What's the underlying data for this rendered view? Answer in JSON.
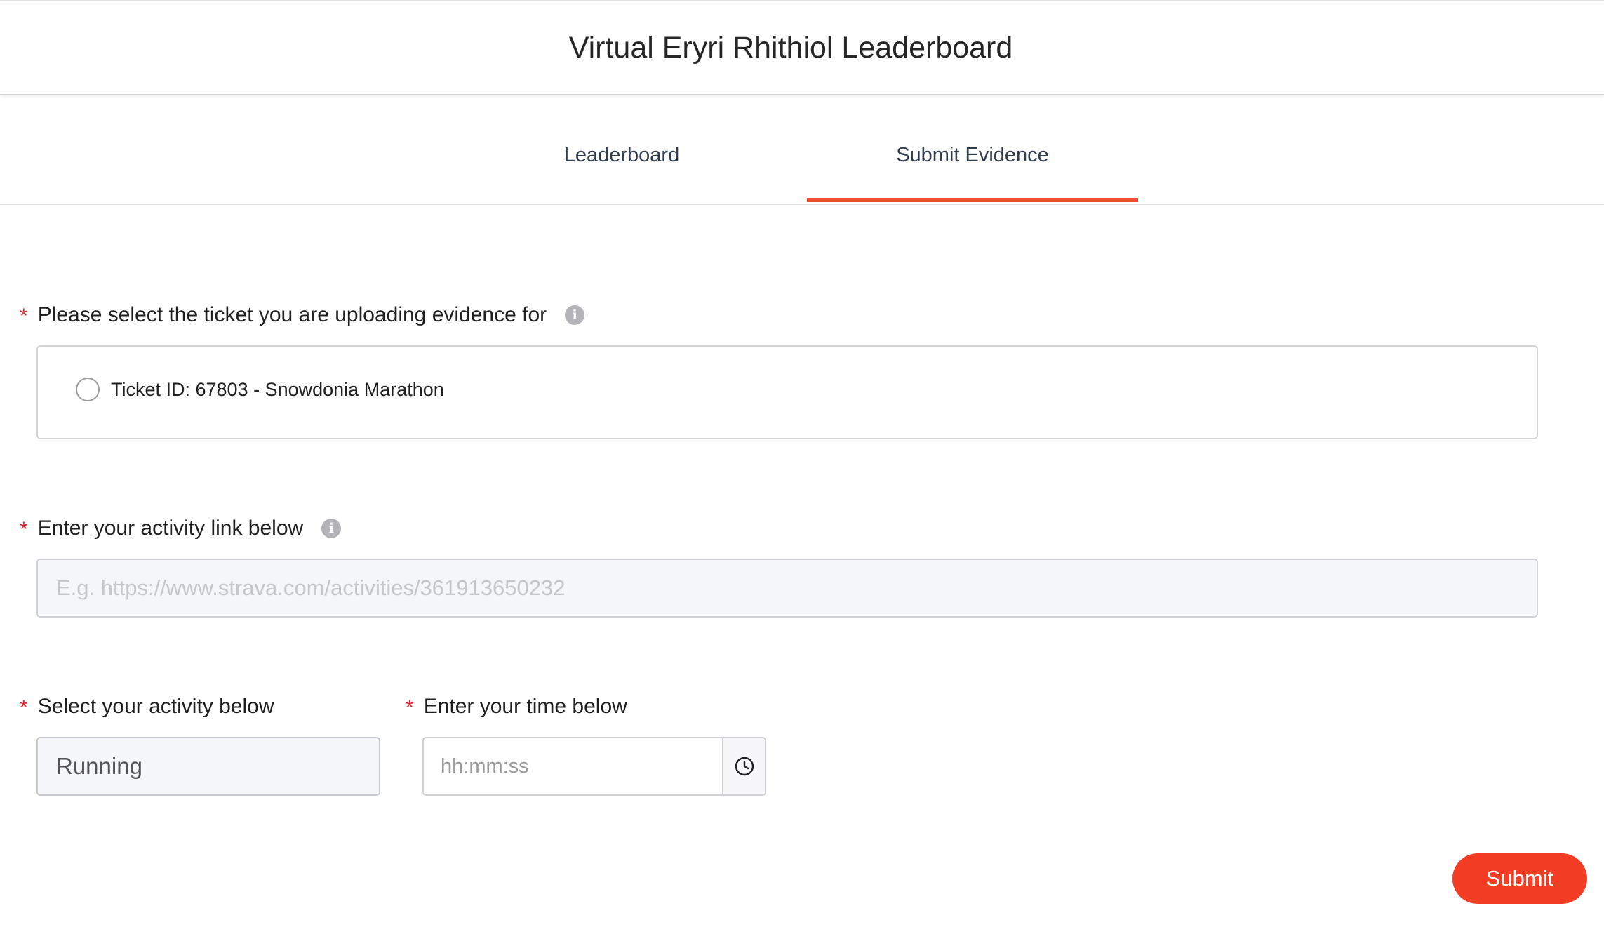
{
  "header": {
    "title": "Virtual Eryri Rhithiol Leaderboard"
  },
  "tabs": [
    {
      "label": "Leaderboard",
      "active": false
    },
    {
      "label": "Submit Evidence",
      "active": true
    }
  ],
  "colors": {
    "accent": "#ee4d36",
    "submit": "#f23d24",
    "required": "#e0262d"
  },
  "form": {
    "ticket": {
      "required_mark": "*",
      "label": "Please select the ticket you are uploading evidence for",
      "info_icon": "info-icon",
      "options": [
        {
          "label": "Ticket ID: 67803 - Snowdonia Marathon",
          "selected": false
        }
      ]
    },
    "activity_link": {
      "required_mark": "*",
      "label": "Enter your activity link below",
      "info_icon": "info-icon",
      "placeholder": "E.g. https://www.strava.com/activities/361913650232",
      "value": ""
    },
    "activity": {
      "required_mark": "*",
      "label": "Select your activity below",
      "value": "Running"
    },
    "time": {
      "required_mark": "*",
      "label": "Enter your time below",
      "placeholder": "hh:mm:ss",
      "value": "",
      "icon": "clock-icon"
    },
    "submit_label": "Submit"
  }
}
